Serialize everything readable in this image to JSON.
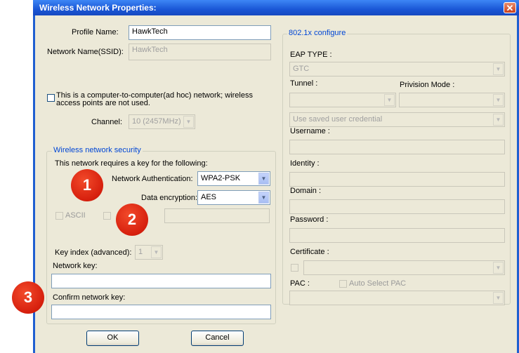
{
  "window": {
    "title": "Wireless Network Properties:",
    "close_glyph": "✕"
  },
  "profile": {
    "label": "Profile Name:",
    "value": "HawkTech"
  },
  "ssid": {
    "label": "Network Name(SSID):",
    "value": "HawkTech"
  },
  "adhoc": {
    "label_line1": "This is a computer-to-computer(ad hoc) network; wireless",
    "label_line2": "access points are not used."
  },
  "channel": {
    "label": "Channel:",
    "value": "10 (2457MHz)"
  },
  "security": {
    "group_title": "Wireless network security",
    "requires_key_text": "This network requires a key for the following:",
    "auth_label": "Network Authentication:",
    "auth_value": "WPA2-PSK",
    "enc_label": "Data encryption:",
    "enc_value": "AES",
    "ascii_label": "ASCII",
    "key_index_label": "Key index (advanced):",
    "key_index_value": "1",
    "network_key_label": "Network key:",
    "confirm_key_label": "Confirm network key:"
  },
  "dot1x": {
    "group_title": "802.1x configure",
    "eap_label": "EAP TYPE :",
    "eap_value": "GTC",
    "tunnel_label": "Tunnel :",
    "provision_label": "Privision Mode :",
    "credential_value": "Use saved user credential",
    "username_label": "Username :",
    "identity_label": "Identity :",
    "domain_label": "Domain :",
    "password_label": "Password :",
    "certificate_label": "Certificate :",
    "pac_label": "PAC :",
    "auto_pac_label": "Auto Select PAC"
  },
  "buttons": {
    "ok": "OK",
    "cancel": "Cancel"
  },
  "badges": {
    "one": "1",
    "two": "2",
    "three": "3"
  },
  "colors": {
    "title_bar": "#1a57d6",
    "dialog_bg": "#ece9d8",
    "group_title": "#0046d5",
    "badge": "#d61f0d"
  },
  "icons": {
    "dropdown": "▼"
  }
}
